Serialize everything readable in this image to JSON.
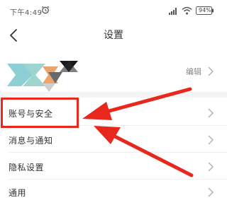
{
  "status_bar": {
    "time": "下午4:49",
    "battery": "94%",
    "icons": [
      "alarm-icon",
      "signal-icon",
      "wifi-icon",
      "battery-icon"
    ]
  },
  "nav": {
    "title": "设置",
    "back_icon": "back-arrow-icon"
  },
  "profile": {
    "edit_label": "编辑"
  },
  "settings": [
    {
      "label": "账号与安全"
    },
    {
      "label": "消息与通知"
    },
    {
      "label": "隐私设置"
    },
    {
      "label": "通用"
    }
  ],
  "annotation": {
    "highlight_color": "#e8281d",
    "arrow_color": "#e8281d"
  }
}
